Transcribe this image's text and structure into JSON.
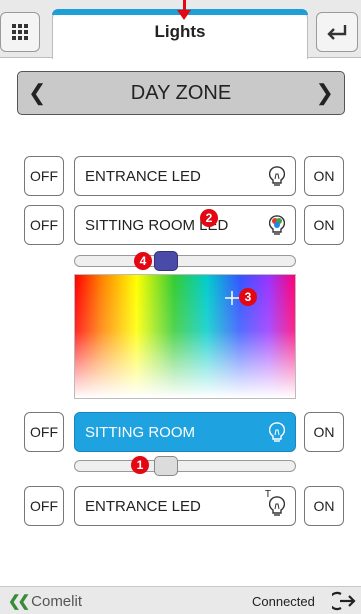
{
  "header": {
    "title": "Lights",
    "menu_icon": "grid-icon",
    "back_icon": "return-arrow-icon"
  },
  "zone": {
    "name": "DAY ZONE",
    "prev_icon": "chevron-left-icon",
    "next_icon": "chevron-right-icon"
  },
  "rows": [
    {
      "off": "OFF",
      "name": "ENTRANCE LED",
      "on": "ON",
      "icon": "bulb-icon"
    },
    {
      "off": "OFF",
      "name": "SITTING ROOM LED",
      "on": "ON",
      "icon": "rgb-bulb-icon"
    },
    {
      "off": "OFF",
      "name": "SITTING ROOM",
      "on": "ON",
      "icon": "bulb-icon"
    },
    {
      "off": "OFF",
      "name": "ENTRANCE LED",
      "on": "ON",
      "icon": "bulb-timer-icon",
      "icon_label": "T"
    }
  ],
  "sliders": {
    "rgb_level_percent": 40,
    "dimmer_level_percent": 40
  },
  "annotations": [
    "1",
    "2",
    "3",
    "4"
  ],
  "footer": {
    "brand": "Comelit",
    "status": "Connected",
    "logout_icon": "logout-icon"
  },
  "colors": {
    "accent": "#1ea2e0",
    "annotation": "#e30613",
    "rgb_thumb": "#4a4aa8"
  }
}
